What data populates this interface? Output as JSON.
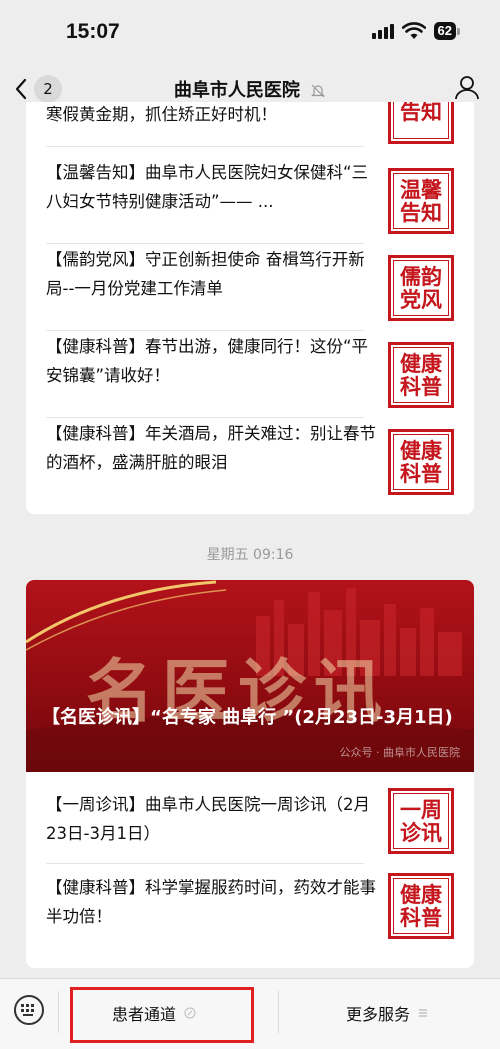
{
  "status": {
    "time": "15:07",
    "battery": "62"
  },
  "nav": {
    "back_count": "2",
    "title": "曲阜市人民医院"
  },
  "card_a": {
    "items": [
      {
        "text": "寒假黄金期，抓住矫正好时机！",
        "thumb": "告知"
      },
      {
        "text": "【温馨告知】曲阜市人民医院妇女保健科“三八妇女节特别健康活动”—— ...",
        "thumb": "温馨告知"
      },
      {
        "text": "【儒韵党风】守正创新担使命 奋楫笃行开新局--一月份党建工作清单",
        "thumb": "儒韵党风"
      },
      {
        "text": "【健康科普】春节出游，健康同行！这份“平安锦囊”请收好！",
        "thumb": "健康科普"
      },
      {
        "text": "【健康科普】年关酒局，肝关难过：别让春节的酒杯，盛满肝脏的眼泪",
        "thumb": "健康科普"
      }
    ]
  },
  "time_separator": "星期五 09:16",
  "card_b": {
    "banner_big_text": "名医诊讯",
    "banner_title": "【名医诊讯】“名专家 曲阜行 ”(2月23日-3月1日)",
    "watermark": "公众号 · 曲阜市人民医院",
    "items": [
      {
        "text": "【一周诊讯】曲阜市人民医院一周诊讯（2月23日-3月1日）",
        "thumb": "一周诊讯"
      },
      {
        "text": "【健康科普】科学掌握服药时间，药效才能事半功倍！",
        "thumb": "健康科普"
      }
    ]
  },
  "bottom_menu": {
    "left": "患者通道",
    "right": "更多服务",
    "highlight_color": "#e02020"
  },
  "colors": {
    "brand_red": "#c4161c"
  }
}
